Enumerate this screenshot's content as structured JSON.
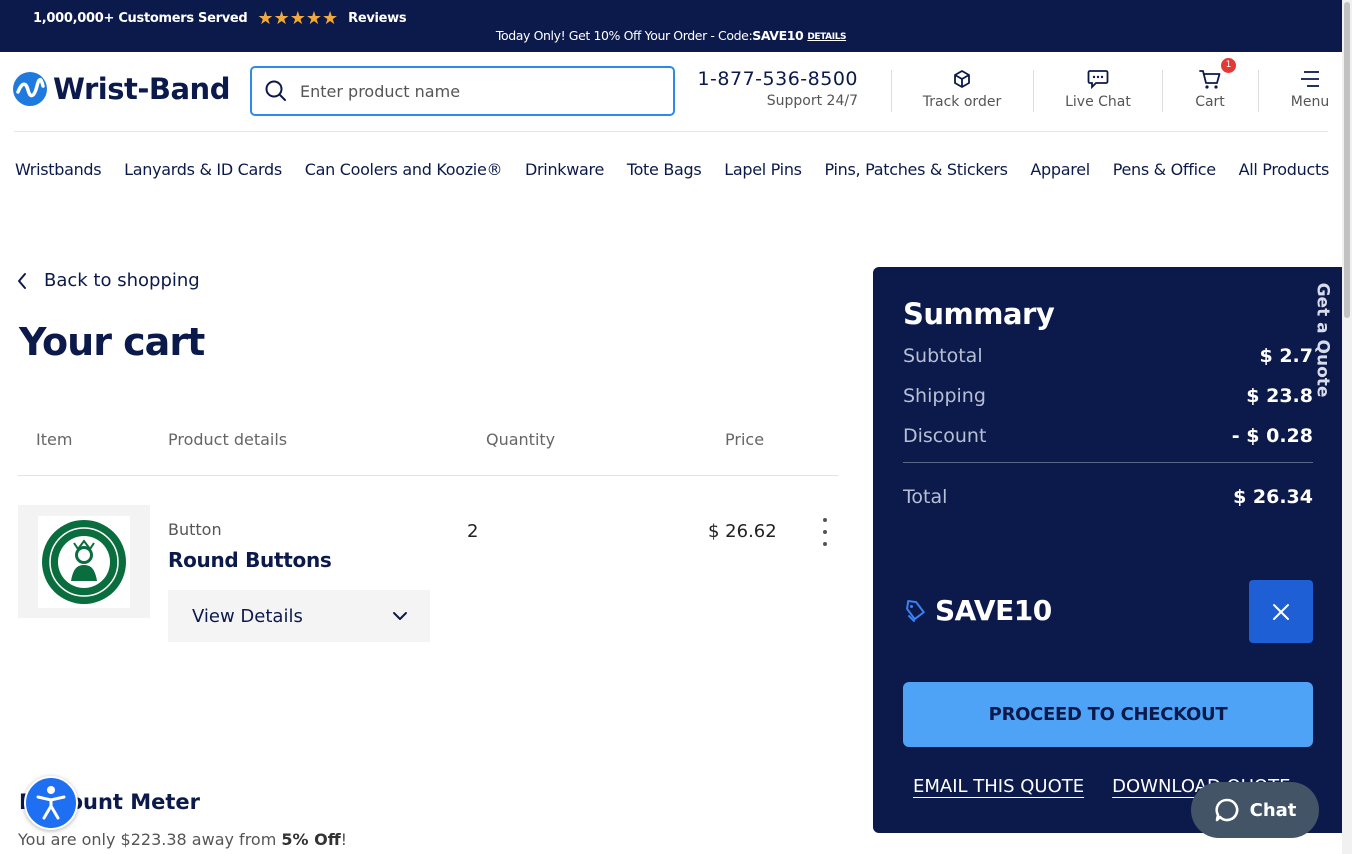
{
  "promo": {
    "customers": "1,000,000+ Customers Served",
    "stars": "★★★★★",
    "reviews": "Reviews",
    "offer_text": "Today Only! Get 10% Off Your Order - Code:",
    "offer_code": "SAVE10",
    "details": "DETAILS"
  },
  "header": {
    "logo_text": "Wrist-Band",
    "search_placeholder": "Enter product name",
    "phone": "1-877-536-8500",
    "support": "Support 24/7",
    "track_order": "Track order",
    "live_chat": "Live Chat",
    "cart": "Cart",
    "cart_count": "1",
    "menu": "Menu"
  },
  "nav": {
    "items": [
      "Wristbands",
      "Lanyards & ID Cards",
      "Can Coolers and Koozie®",
      "Drinkware",
      "Tote Bags",
      "Lapel Pins",
      "Pins, Patches & Stickers",
      "Apparel",
      "Pens & Office",
      "All Products"
    ]
  },
  "cart": {
    "back": "Back to shopping",
    "title": "Your cart",
    "columns": [
      "Item",
      "Product details",
      "Quantity",
      "Price"
    ],
    "item": {
      "category": "Button",
      "name": "Round Buttons",
      "view_details": "View Details",
      "quantity": "2",
      "price": "$ 26.62"
    },
    "meter_title": "Discount Meter",
    "meter_prefix": "You are only $223.38 away from ",
    "meter_pct": "5% Off",
    "meter_suffix": "!"
  },
  "summary": {
    "title": "Summary",
    "subtotal_label": "Subtotal",
    "subtotal_value": "$ 2.7",
    "shipping_label": "Shipping",
    "shipping_value": "$ 23.8",
    "discount_label": "Discount",
    "discount_value": "- $ 0.28",
    "total_label": "Total",
    "total_value": "$ 26.34",
    "coupon_code": "SAVE10",
    "checkout": "PROCEED TO CHECKOUT",
    "email_quote": "EMAIL THIS QUOTE",
    "download_quote": "DOWNLOAD QUOTE",
    "get_quote": "Get a Quote"
  },
  "chat": {
    "label": "Chat"
  },
  "colors": {
    "navy": "#0c1a4b",
    "accent": "#4ea3f6",
    "link": "#2c8be8",
    "badge": "#e53935"
  }
}
